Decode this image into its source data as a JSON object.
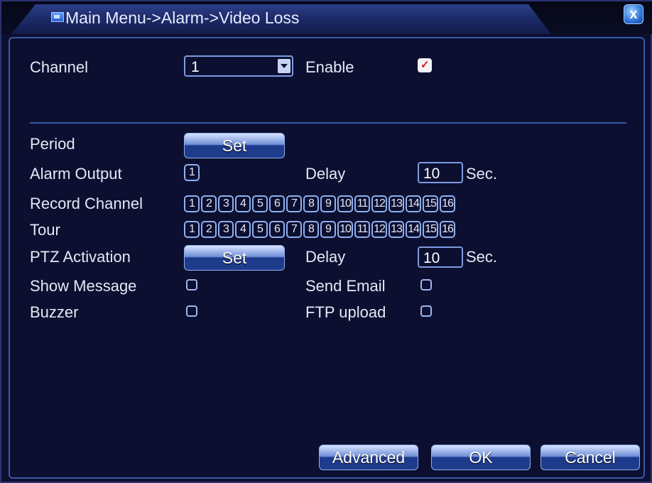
{
  "window": {
    "title": "Main Menu->Alarm->Video Loss",
    "close_label": "x"
  },
  "fields": {
    "channel": {
      "label": "Channel",
      "value": "1"
    },
    "enable": {
      "label": "Enable",
      "checked": true
    },
    "period": {
      "label": "Period",
      "button": "Set"
    },
    "alarm_output": {
      "label": "Alarm Output",
      "value": "1"
    },
    "delay1": {
      "label": "Delay",
      "value": "10",
      "unit": "Sec."
    },
    "record_channel": {
      "label": "Record Channel",
      "channels": [
        "1",
        "2",
        "3",
        "4",
        "5",
        "6",
        "7",
        "8",
        "9",
        "10",
        "11",
        "12",
        "13",
        "14",
        "15",
        "16"
      ]
    },
    "tour": {
      "label": "Tour",
      "channels": [
        "1",
        "2",
        "3",
        "4",
        "5",
        "6",
        "7",
        "8",
        "9",
        "10",
        "11",
        "12",
        "13",
        "14",
        "15",
        "16"
      ]
    },
    "ptz": {
      "label": "PTZ Activation",
      "button": "Set"
    },
    "delay2": {
      "label": "Delay",
      "value": "10",
      "unit": "Sec."
    },
    "show_message": {
      "label": "Show Message",
      "checked": false
    },
    "send_email": {
      "label": "Send Email",
      "checked": false
    },
    "buzzer": {
      "label": "Buzzer",
      "checked": false
    },
    "ftp_upload": {
      "label": "FTP upload",
      "checked": false
    }
  },
  "buttons": {
    "advanced": "Advanced",
    "ok": "OK",
    "cancel": "Cancel"
  },
  "colors": {
    "background": "#0c0f30",
    "border": "#3a58a8",
    "check_mark": "#d01a2a"
  }
}
